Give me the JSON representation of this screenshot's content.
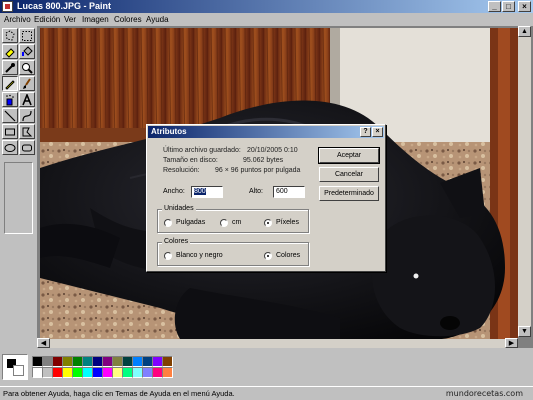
{
  "window": {
    "title": "Lucas 800.JPG - Paint",
    "controls": {
      "minimize": "_",
      "maximize": "□",
      "close": "×"
    }
  },
  "menu": [
    "Archivo",
    "Edición",
    "Ver",
    "Imagen",
    "Colores",
    "Ayuda"
  ],
  "tools": [
    "free-select",
    "rect-select",
    "eraser",
    "fill-bucket",
    "color-picker",
    "magnifier",
    "pencil",
    "brush",
    "airbrush",
    "text",
    "line",
    "curve",
    "rectangle",
    "polygon",
    "ellipse",
    "rounded-rectangle"
  ],
  "palette": {
    "foreground": "#000000",
    "background": "#ffffff",
    "colors": [
      "#000000",
      "#808080",
      "#800000",
      "#808000",
      "#008000",
      "#008080",
      "#000080",
      "#800080",
      "#808040",
      "#004040",
      "#0080ff",
      "#004080",
      "#8000ff",
      "#804000",
      "#ffffff",
      "#c0c0c0",
      "#ff0000",
      "#ffff00",
      "#00ff00",
      "#00ffff",
      "#0000ff",
      "#ff00ff",
      "#ffff80",
      "#00ff80",
      "#80ffff",
      "#8080ff",
      "#ff0080",
      "#ff8040"
    ]
  },
  "dialog": {
    "title": "Atributos",
    "help_button": "?",
    "close_button": "×",
    "last_saved_label": "Último archivo guardado:",
    "last_saved_value": "20/10/2005 0:10",
    "disk_size_label": "Tamaño en disco:",
    "disk_size_value": "95.062 bytes",
    "resolution_label": "Resolución:",
    "resolution_value": "96 × 96 puntos por pulgada",
    "width_label": "Ancho:",
    "width_value": "800",
    "height_label": "Alto:",
    "height_value": "600",
    "units_group": "Unidades",
    "units_options": [
      "Pulgadas",
      "cm",
      "Píxeles"
    ],
    "units_selected": "Píxeles",
    "colors_group": "Colores",
    "colors_options": [
      "Blanco y negro",
      "Colores"
    ],
    "colors_selected": "Colores",
    "ok_button": "Aceptar",
    "cancel_button": "Cancelar",
    "default_button": "Predeterminado"
  },
  "statusbar": {
    "text": "Para obtener Ayuda, haga clic en Temas de Ayuda en el menú Ayuda.",
    "watermark": "mundorecetas.com"
  }
}
